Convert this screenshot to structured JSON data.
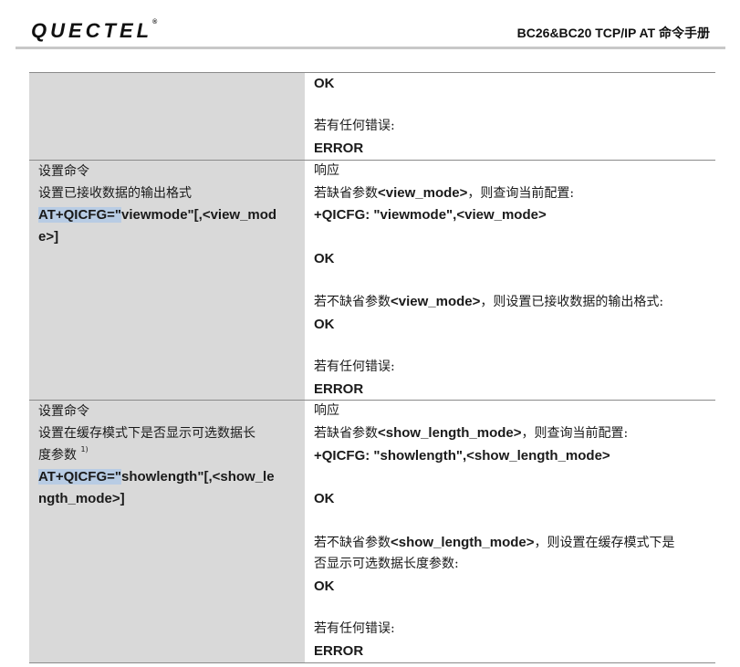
{
  "header": {
    "logo": "QUECTEL",
    "doc_title": "BC26&BC20  TCP/IP  AT 命令手册"
  },
  "rows": [
    {
      "right": {
        "ok": "OK",
        "error_prefix": "若有任何错误:",
        "error": "ERROR"
      }
    },
    {
      "left": {
        "type": "设置命令",
        "desc": "设置已接收数据的输出格式",
        "cmd_hl": "AT+QICFG=\"",
        "cmd_line1_rest": "viewmode\"[,<view_mod",
        "cmd_line2": "e>]"
      },
      "right": {
        "response": "响应",
        "query_prefix": "若缺省参数",
        "query_param": "<view_mode>",
        "query_suffix": "，则查询当前配置:",
        "query_result": "+QICFG: \"viewmode\",<view_mode>",
        "ok1": "OK",
        "set_prefix": "若不缺省参数",
        "set_param": "<view_mode>",
        "set_suffix": "，则设置已接收数据的输出格式:",
        "ok2": "OK",
        "error_prefix": "若有任何错误:",
        "error": "ERROR"
      }
    },
    {
      "left": {
        "type": "设置命令",
        "desc_line1": "设置在缓存模式下是否显示可选数据长",
        "desc_line2": "度参数",
        "footnote": "1)",
        "cmd_hl": "AT+QICFG=\"",
        "cmd_line1_rest": "showlength\"[,<show_le",
        "cmd_line2": "ngth_mode>]"
      },
      "right": {
        "response": "响应",
        "query_prefix": "若缺省参数",
        "query_param": "<show_length_mode>",
        "query_suffix": "，则查询当前配置:",
        "query_result": "+QICFG: \"showlength\",<show_length_mode>",
        "ok1": "OK",
        "set_prefix": "若不缺省参数",
        "set_param": "<show_length_mode>",
        "set_suffix": "，则设置在缓存模式下是",
        "set_line2": "否显示可选数据长度参数:",
        "ok2": "OK",
        "error_prefix": "若有任何错误:",
        "error": "ERROR"
      }
    }
  ]
}
